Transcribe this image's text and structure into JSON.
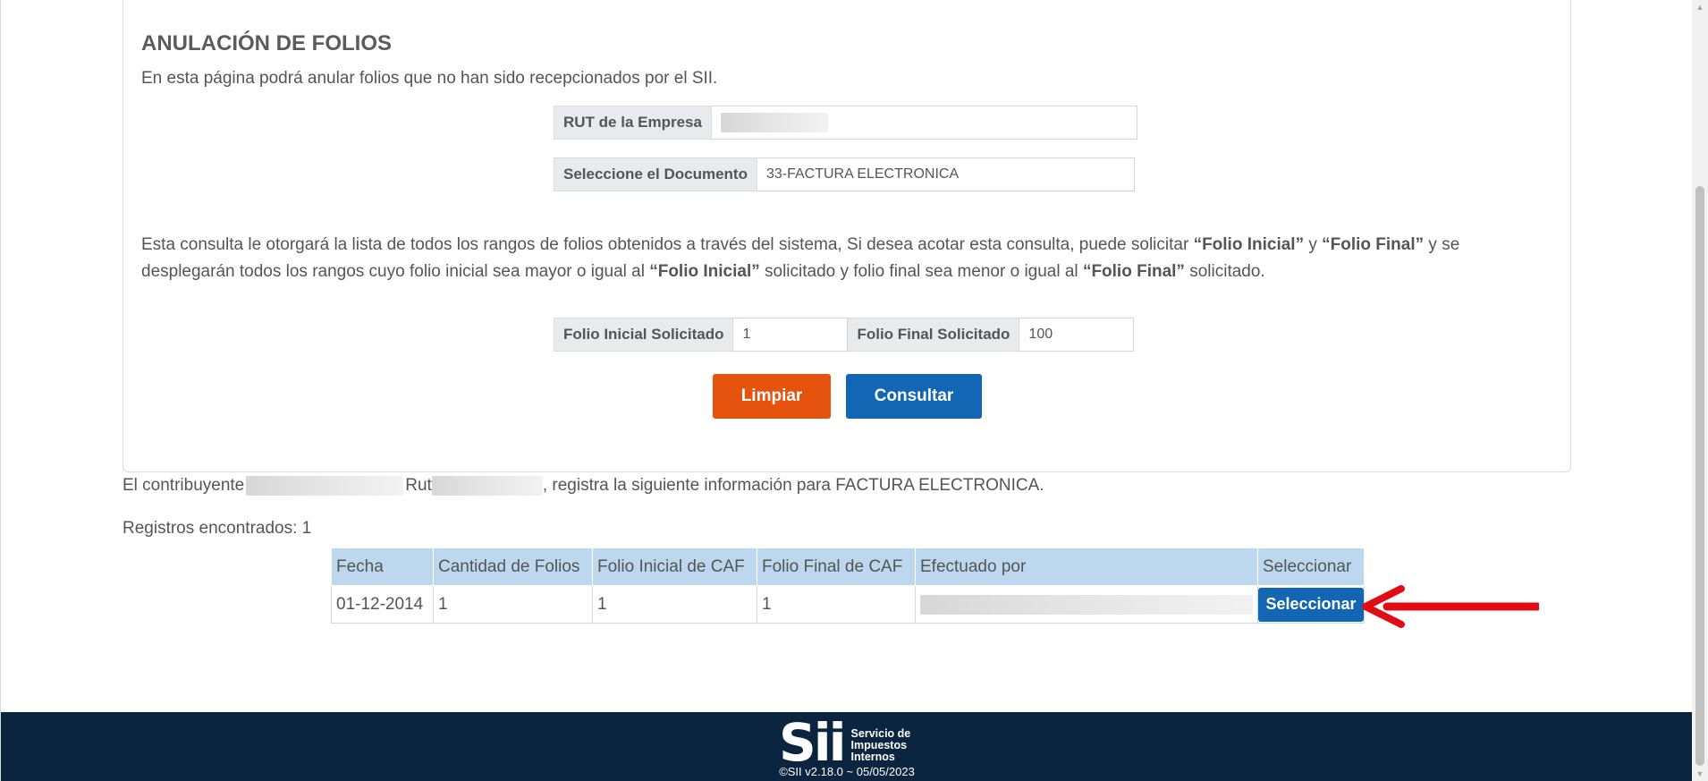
{
  "panel": {
    "title": "ANULACIÓN DE FOLIOS",
    "subtitle": "En esta página podrá anular folios que no han sido recepcionados por el SII."
  },
  "form": {
    "rut_label": "RUT de la Empresa",
    "rut_value": "",
    "document_label": "Seleccione el Documento",
    "document_value": "33-FACTURA ELECTRONICA",
    "folio_inicial_label": "Folio Inicial Solicitado",
    "folio_inicial_value": "1",
    "folio_final_label": "Folio Final Solicitado",
    "folio_final_value": "100"
  },
  "info": {
    "part1": "Esta consulta le otorgará la lista de todos los rangos de folios obtenidos a través del sistema, Si desea acotar esta consulta, puede solicitar ",
    "bold1": "“Folio Inicial”",
    "part2": " y ",
    "bold2": "“Folio Final”",
    "part3": " y se desplegarán todos los rangos cuyo folio inicial sea mayor o igual al ",
    "bold3": "“Folio Inicial”",
    "part4": " solicitado y folio final sea menor o igual al ",
    "bold4": "“Folio Final”",
    "part5": " solicitado."
  },
  "buttons": {
    "clear_label": "Limpiar",
    "query_label": "Consultar"
  },
  "result": {
    "contrib_prefix": "El contribuyente",
    "rut_prefix": "Rut",
    "contrib_suffix": ", registra la siguiente información para FACTURA ELECTRONICA.",
    "records_label": "Registros encontrados: 1"
  },
  "table": {
    "headers": [
      "Fecha",
      "Cantidad de Folios",
      "Folio Inicial de CAF",
      "Folio Final de CAF",
      "Efectuado por",
      "Seleccionar"
    ],
    "rows": [
      {
        "fecha": "01-12-2014",
        "cantidad": "1",
        "folio_inicial": "1",
        "folio_final": "1",
        "efectuado_por": "",
        "select_label": "Seleccionar"
      }
    ]
  },
  "footer": {
    "logo_mark": "Sii",
    "logo_text_line1": "Servicio de",
    "logo_text_line2": "Impuestos",
    "logo_text_line3": "Internos",
    "version": "©SII v2.18.0 ~ 05/05/2023"
  },
  "colors": {
    "accent_orange": "#e6530f",
    "accent_blue": "#1266b4",
    "table_header": "#bcd7ee",
    "footer_bg": "#0b2540",
    "annotation_arrow": "#e10d14"
  }
}
